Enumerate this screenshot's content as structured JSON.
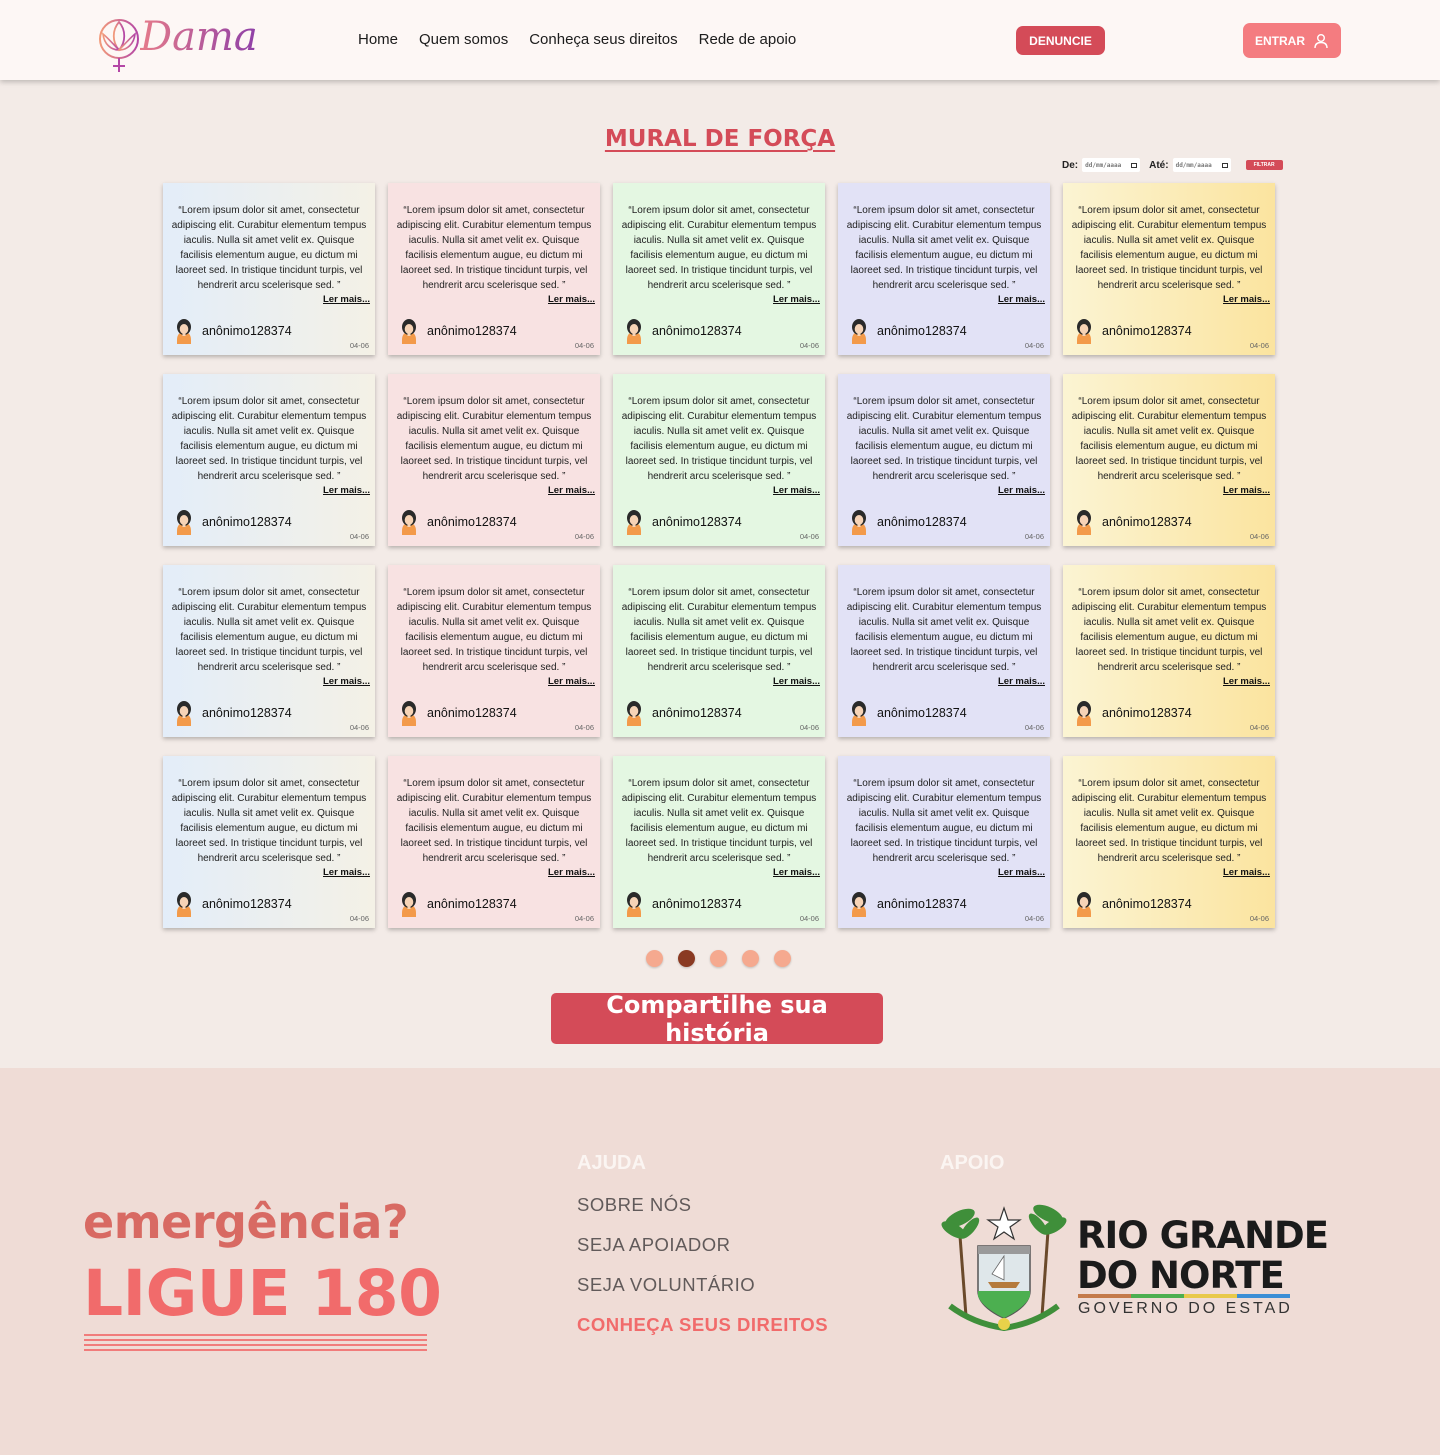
{
  "header": {
    "logo_text": "Dama",
    "nav": [
      "Home",
      "Quem somos",
      "Conheça seus direitos",
      "Rede de apoio"
    ],
    "denuncie_label": "DENUNCIE",
    "entrar_label": "ENTRAR"
  },
  "mural": {
    "title": "MURAL DE FORÇA",
    "filter": {
      "from_label": "De:",
      "to_label": "Até:",
      "from_placeholder": "dd/mm/aaaa",
      "to_placeholder": "dd/mm/aaaa",
      "button_label": "FILTRAR"
    },
    "cards": [
      {
        "text": "“Lorem ipsum dolor sit amet, consectetur adipiscing elit. Curabitur elementum tempus iaculis. Nulla sit amet velit ex. Quisque facilisis elementum augue, eu dictum mi laoreet sed. In tristique tincidunt turpis, vel hendrerit arcu scelerisque sed. ”",
        "more": "Ler mais...",
        "user": "anônimo128374",
        "date": "04-06"
      },
      {
        "text": "“Lorem ipsum dolor sit amet, consectetur adipiscing elit. Curabitur elementum tempus iaculis. Nulla sit amet velit ex. Quisque facilisis elementum augue, eu dictum mi laoreet sed. In tristique tincidunt turpis, vel hendrerit arcu scelerisque sed. ”",
        "more": "Ler mais...",
        "user": "anônimo128374",
        "date": "04-06"
      },
      {
        "text": "“Lorem ipsum dolor sit amet, consectetur adipiscing elit. Curabitur elementum tempus iaculis. Nulla sit amet velit ex. Quisque facilisis elementum augue, eu dictum mi laoreet sed. In tristique tincidunt turpis, vel hendrerit arcu scelerisque sed. ”",
        "more": "Ler mais...",
        "user": "anônimo128374",
        "date": "04-06"
      },
      {
        "text": "“Lorem ipsum dolor sit amet, consectetur adipiscing elit. Curabitur elementum tempus iaculis. Nulla sit amet velit ex. Quisque facilisis elementum augue, eu dictum mi laoreet sed. In tristique tincidunt turpis, vel hendrerit arcu scelerisque sed. ”",
        "more": "Ler mais...",
        "user": "anônimo128374",
        "date": "04-06"
      },
      {
        "text": "“Lorem ipsum dolor sit amet, consectetur adipiscing elit. Curabitur elementum tempus iaculis. Nulla sit amet velit ex. Quisque facilisis elementum augue, eu dictum mi laoreet sed. In tristique tincidunt turpis, vel hendrerit arcu scelerisque sed. ”",
        "more": "Ler mais...",
        "user": "anônimo128374",
        "date": "04-06"
      },
      {
        "text": "“Lorem ipsum dolor sit amet, consectetur adipiscing elit. Curabitur elementum tempus iaculis. Nulla sit amet velit ex. Quisque facilisis elementum augue, eu dictum mi laoreet sed. In tristique tincidunt turpis, vel hendrerit arcu scelerisque sed. ”",
        "more": "Ler mais...",
        "user": "anônimo128374",
        "date": "04-06"
      },
      {
        "text": "“Lorem ipsum dolor sit amet, consectetur adipiscing elit. Curabitur elementum tempus iaculis. Nulla sit amet velit ex. Quisque facilisis elementum augue, eu dictum mi laoreet sed. In tristique tincidunt turpis, vel hendrerit arcu scelerisque sed. ”",
        "more": "Ler mais...",
        "user": "anônimo128374",
        "date": "04-06"
      },
      {
        "text": "“Lorem ipsum dolor sit amet, consectetur adipiscing elit. Curabitur elementum tempus iaculis. Nulla sit amet velit ex. Quisque facilisis elementum augue, eu dictum mi laoreet sed. In tristique tincidunt turpis, vel hendrerit arcu scelerisque sed. ”",
        "more": "Ler mais...",
        "user": "anônimo128374",
        "date": "04-06"
      },
      {
        "text": "“Lorem ipsum dolor sit amet, consectetur adipiscing elit. Curabitur elementum tempus iaculis. Nulla sit amet velit ex. Quisque facilisis elementum augue, eu dictum mi laoreet sed. In tristique tincidunt turpis, vel hendrerit arcu scelerisque sed. ”",
        "more": "Ler mais...",
        "user": "anônimo128374",
        "date": "04-06"
      },
      {
        "text": "“Lorem ipsum dolor sit amet, consectetur adipiscing elit. Curabitur elementum tempus iaculis. Nulla sit amet velit ex. Quisque facilisis elementum augue, eu dictum mi laoreet sed. In tristique tincidunt turpis, vel hendrerit arcu scelerisque sed. ”",
        "more": "Ler mais...",
        "user": "anônimo128374",
        "date": "04-06"
      },
      {
        "text": "“Lorem ipsum dolor sit amet, consectetur adipiscing elit. Curabitur elementum tempus iaculis. Nulla sit amet velit ex. Quisque facilisis elementum augue, eu dictum mi laoreet sed. In tristique tincidunt turpis, vel hendrerit arcu scelerisque sed. ”",
        "more": "Ler mais...",
        "user": "anônimo128374",
        "date": "04-06"
      },
      {
        "text": "“Lorem ipsum dolor sit amet, consectetur adipiscing elit. Curabitur elementum tempus iaculis. Nulla sit amet velit ex. Quisque facilisis elementum augue, eu dictum mi laoreet sed. In tristique tincidunt turpis, vel hendrerit arcu scelerisque sed. ”",
        "more": "Ler mais...",
        "user": "anônimo128374",
        "date": "04-06"
      },
      {
        "text": "“Lorem ipsum dolor sit amet, consectetur adipiscing elit. Curabitur elementum tempus iaculis. Nulla sit amet velit ex. Quisque facilisis elementum augue, eu dictum mi laoreet sed. In tristique tincidunt turpis, vel hendrerit arcu scelerisque sed. ”",
        "more": "Ler mais...",
        "user": "anônimo128374",
        "date": "04-06"
      },
      {
        "text": "“Lorem ipsum dolor sit amet, consectetur adipiscing elit. Curabitur elementum tempus iaculis. Nulla sit amet velit ex. Quisque facilisis elementum augue, eu dictum mi laoreet sed. In tristique tincidunt turpis, vel hendrerit arcu scelerisque sed. ”",
        "more": "Ler mais...",
        "user": "anônimo128374",
        "date": "04-06"
      },
      {
        "text": "“Lorem ipsum dolor sit amet, consectetur adipiscing elit. Curabitur elementum tempus iaculis. Nulla sit amet velit ex. Quisque facilisis elementum augue, eu dictum mi laoreet sed. In tristique tincidunt turpis, vel hendrerit arcu scelerisque sed. ”",
        "more": "Ler mais...",
        "user": "anônimo128374",
        "date": "04-06"
      },
      {
        "text": "“Lorem ipsum dolor sit amet, consectetur adipiscing elit. Curabitur elementum tempus iaculis. Nulla sit amet velit ex. Quisque facilisis elementum augue, eu dictum mi laoreet sed. In tristique tincidunt turpis, vel hendrerit arcu scelerisque sed. ”",
        "more": "Ler mais...",
        "user": "anônimo128374",
        "date": "04-06"
      },
      {
        "text": "“Lorem ipsum dolor sit amet, consectetur adipiscing elit. Curabitur elementum tempus iaculis. Nulla sit amet velit ex. Quisque facilisis elementum augue, eu dictum mi laoreet sed. In tristique tincidunt turpis, vel hendrerit arcu scelerisque sed. ”",
        "more": "Ler mais...",
        "user": "anônimo128374",
        "date": "04-06"
      },
      {
        "text": "“Lorem ipsum dolor sit amet, consectetur adipiscing elit. Curabitur elementum tempus iaculis. Nulla sit amet velit ex. Quisque facilisis elementum augue, eu dictum mi laoreet sed. In tristique tincidunt turpis, vel hendrerit arcu scelerisque sed. ”",
        "more": "Ler mais...",
        "user": "anônimo128374",
        "date": "04-06"
      },
      {
        "text": "“Lorem ipsum dolor sit amet, consectetur adipiscing elit. Curabitur elementum tempus iaculis. Nulla sit amet velit ex. Quisque facilisis elementum augue, eu dictum mi laoreet sed. In tristique tincidunt turpis, vel hendrerit arcu scelerisque sed. ”",
        "more": "Ler mais...",
        "user": "anônimo128374",
        "date": "04-06"
      },
      {
        "text": "“Lorem ipsum dolor sit amet, consectetur adipiscing elit. Curabitur elementum tempus iaculis. Nulla sit amet velit ex. Quisque facilisis elementum augue, eu dictum mi laoreet sed. In tristique tincidunt turpis, vel hendrerit arcu scelerisque sed. ”",
        "more": "Ler mais...",
        "user": "anônimo128374",
        "date": "04-06"
      }
    ],
    "card_colors": [
      "c0",
      "c1",
      "c2",
      "c3",
      "c4"
    ],
    "pagination": {
      "count": 5,
      "active": 2
    },
    "share_label": "Compartilhe sua história"
  },
  "footer": {
    "emergency": "emergência?",
    "call": "LIGUE 180",
    "help_title": "AJUDA",
    "help_links": [
      "SOBRE NÓS",
      "SEJA APOIADOR",
      "SEJA VOLUNTÁRIO",
      "CONHEÇA SEUS DIREITOS"
    ],
    "support_title": "APOIO",
    "gov": {
      "line1": "RIO GRANDE",
      "line2": "DO NORTE",
      "sub": "GOVERNO DO ESTADO"
    }
  },
  "colors": {
    "brand_red": "#d44b58",
    "salmon": "#f47c80",
    "emergency_red": "#f16b6b"
  }
}
